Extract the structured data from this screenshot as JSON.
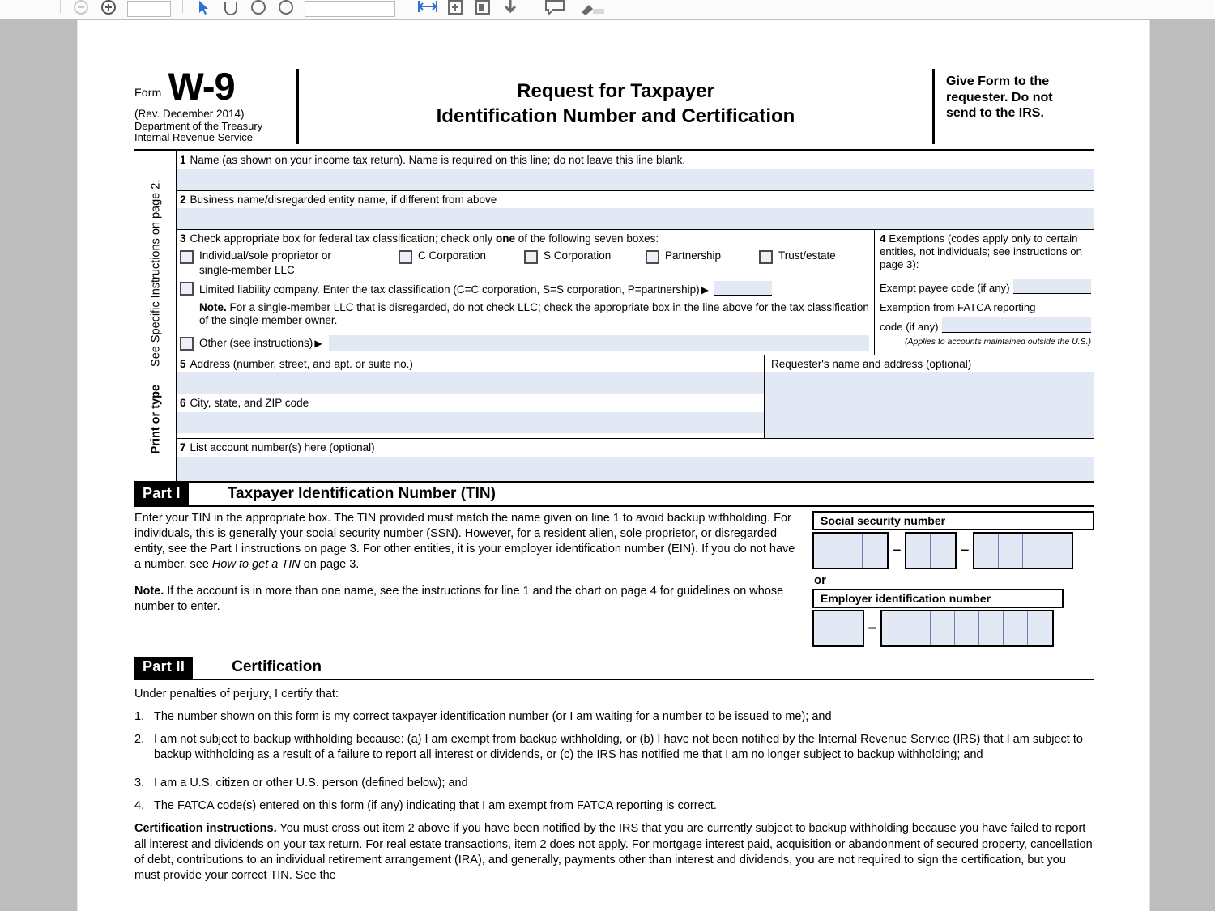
{
  "toolbar": {
    "icons": [
      "zoom-out-icon",
      "zoom-in-icon",
      "page-number-input",
      "select-tool-icon",
      "hand-tool-icon",
      "zoom-select-icon",
      "marquee-zoom-icon",
      "zoom-level-input",
      "fit-width-icon",
      "add-page-icon",
      "extract-page-icon",
      "download-icon",
      "comment-icon",
      "highlight-icon"
    ],
    "page_number_value": "",
    "zoom_level_value": ""
  },
  "header": {
    "form_label": "Form",
    "form_number": "W-9",
    "revision": "(Rev. December 2014)",
    "department_line1": "Department of the Treasury",
    "department_line2": "Internal Revenue Service",
    "title_line1": "Request for Taxpayer",
    "title_line2": "Identification Number and Certification",
    "give_form_line1": "Give Form to the",
    "give_form_line2": "requester. Do not",
    "give_form_line3": "send to the IRS."
  },
  "sidebar": {
    "print_or_type": "Print or type",
    "see_instructions": "See Specific Instructions on page 2."
  },
  "lines": {
    "line1": {
      "num": "1",
      "label": "Name (as shown on your income tax return). Name is required on this line; do not leave this line blank.",
      "value": ""
    },
    "line2": {
      "num": "2",
      "label": "Business name/disregarded entity name, if different from above",
      "value": ""
    },
    "line3": {
      "num": "3",
      "label_part1": "Check appropriate box for federal tax classification; check only ",
      "label_bold": "one",
      "label_part2": " of the following seven boxes:",
      "checkboxes": [
        {
          "id": "individual",
          "label": "Individual/sole proprietor or",
          "label2": "single-member LLC",
          "checked": false
        },
        {
          "id": "c-corporation",
          "label": "C Corporation",
          "checked": false
        },
        {
          "id": "s-corporation",
          "label": "S Corporation",
          "checked": false
        },
        {
          "id": "partnership",
          "label": "Partnership",
          "checked": false
        },
        {
          "id": "trust-estate",
          "label": "Trust/estate",
          "checked": false
        }
      ],
      "llc_label": "Limited liability company. Enter the tax classification (C=C corporation, S=S corporation, P=partnership)",
      "llc_value": "",
      "note_bold": "Note.",
      "note_text": " For a single-member LLC that is disregarded, do not check LLC; check the appropriate box in the line above for the tax classification of the single-member owner.",
      "other_label": "Other (see instructions)",
      "other_value": ""
    },
    "line4": {
      "num": "4",
      "label": "Exemptions (codes apply only to certain entities, not individuals; see instructions on page 3):",
      "exempt_payee_label": "Exempt payee code (if any)",
      "exempt_payee_value": "",
      "fatca_label_line1": "Exemption from FATCA reporting",
      "fatca_label_line2": "code (if any)",
      "fatca_value": "",
      "applies_note": "(Applies to accounts maintained outside the U.S.)"
    },
    "line5": {
      "num": "5",
      "label": "Address (number, street, and apt. or suite no.)",
      "value": ""
    },
    "line6": {
      "num": "6",
      "label": "City, state, and ZIP code",
      "value": ""
    },
    "line7": {
      "num": "7",
      "label": "List account number(s) here (optional)",
      "value": ""
    },
    "requester": {
      "label": "Requester's name and address (optional)",
      "value": ""
    }
  },
  "part1": {
    "tag": "Part I",
    "title": "Taxpayer Identification Number (TIN)",
    "para1_a": "Enter your TIN in the appropriate box. The TIN provided must match the name given on line 1 to avoid backup withholding. For individuals, this is generally your social security number (SSN). However, for a resident alien, sole proprietor, or disregarded entity, see the Part I instructions on page 3. For other entities, it is your employer identification number (EIN). If you do not have a number, see ",
    "para1_italic": "How to get a TIN",
    "para1_b": " on page 3.",
    "note_bold": "Note.",
    "note_text": " If the account is in more than one name, see the instructions for line 1 and the chart on page 4 for guidelines on whose number to enter.",
    "ssn_label": "Social security number",
    "ssn_groups": [
      3,
      2,
      4
    ],
    "ssn_value": "",
    "or_label": "or",
    "ein_label": "Employer identification number",
    "ein_groups": [
      2,
      7
    ],
    "ein_value": ""
  },
  "part2": {
    "tag": "Part II",
    "title": "Certification",
    "intro": "Under penalties of perjury, I certify that:",
    "items": [
      {
        "num": "1.",
        "text": "The number shown on this form is my correct taxpayer identification number (or I am waiting for a number to be issued to me); and"
      },
      {
        "num": "2.",
        "text": "I am not subject to backup withholding because: (a) I am exempt from backup withholding, or (b) I have not been notified by the Internal Revenue Service (IRS) that I am subject to backup withholding as a result of a failure to report all interest or dividends, or (c) the IRS has notified me that I am no longer subject to backup withholding; and"
      },
      {
        "num": "3.",
        "text": "I am a U.S. citizen or other U.S. person (defined below); and"
      },
      {
        "num": "4.",
        "text": "The FATCA code(s) entered on this form (if any) indicating that I am exempt from FATCA reporting is correct."
      }
    ],
    "cert_instr_bold": "Certification instructions.",
    "cert_instr_text": " You must cross out item 2 above if you have been notified by the IRS that you are currently subject to backup withholding because you have failed to report all interest and dividends on your tax return. For real estate transactions, item 2 does not apply. For mortgage interest paid, acquisition or abandonment of secured property, cancellation of debt, contributions to an individual retirement arrangement (IRA), and generally, payments other than interest and dividends, you are not required to sign the certification, but you must provide your correct TIN. See the"
  },
  "colors": {
    "field_fill": "#e3e8f5",
    "viewer_bg": "#bdbdbd",
    "page_bg": "#ffffff",
    "rule": "#000000"
  }
}
